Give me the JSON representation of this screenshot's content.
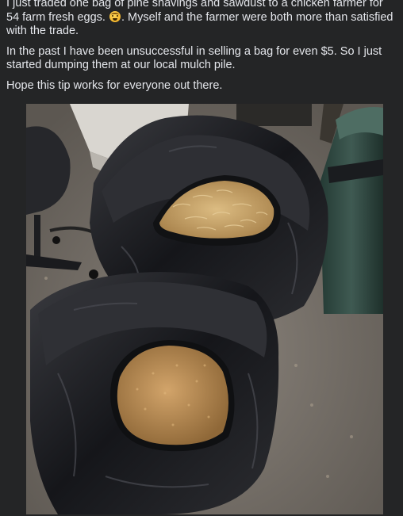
{
  "post": {
    "paragraphs": [
      {
        "before_emoji": "I just traded one bag of pine shavings and sawdust to a chicken farmer for 54 farm fresh eggs. ",
        "emoji": "grimacing-face",
        "after_emoji": ".  Myself and the farmer were both more than satisfied with the trade."
      },
      {
        "text": "In the past I have been unsuccessful in selling a bag for even $5.  So I just started dumping them at our local mulch pile."
      },
      {
        "text": "Hope this tip works for everyone out there."
      }
    ]
  },
  "colors": {
    "background": "#242526",
    "text": "#e4e6eb",
    "bag": "#1b1c1f",
    "shavings": "#c9a469",
    "sawdust": "#b88e55"
  }
}
